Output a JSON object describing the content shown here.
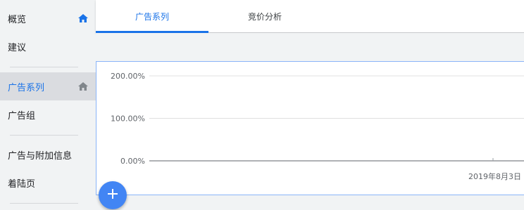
{
  "sidebar": {
    "items": [
      {
        "label": "概览",
        "icon": "home-icon"
      },
      {
        "label": "建议"
      },
      {
        "label": "广告系列",
        "icon": "home-icon",
        "active": true
      },
      {
        "label": "广告组"
      },
      {
        "label": "广告与附加信息"
      },
      {
        "label": "着陆页"
      }
    ]
  },
  "tabs": [
    {
      "label": "广告系列",
      "active": true
    },
    {
      "label": "竞价分析"
    }
  ],
  "colors": {
    "accent": "#1a73e8",
    "fab": "#4285f4",
    "sidebar_bg": "#f1f3f4",
    "active_item_bg": "#dadce0"
  },
  "chart_data": {
    "type": "line",
    "y_ticks": [
      "200.00%",
      "100.00%",
      "0.00%"
    ],
    "ylim": [
      0,
      200
    ],
    "x_labels": [
      "2019年8月3日"
    ],
    "series": [],
    "grid": true
  },
  "fab": {
    "icon": "plus-icon"
  }
}
